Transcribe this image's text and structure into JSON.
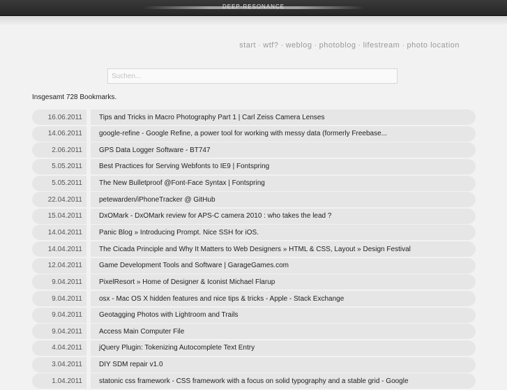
{
  "header": {
    "logo": "DEEP-RESONANCE"
  },
  "nav": {
    "items": [
      "start",
      "wtf?",
      "weblog",
      "photoblog",
      "lifestream",
      "photo location"
    ],
    "separator": "·"
  },
  "search": {
    "placeholder": "Suchen...",
    "value": ""
  },
  "summary": {
    "total_text": "Insgesamt 728 Bookmarks."
  },
  "bookmarks": [
    {
      "date": "16.06.2011",
      "title": "Tips and Tricks in Macro Photography Part 1 | Carl Zeiss Camera Lenses"
    },
    {
      "date": "14.06.2011",
      "title": "google-refine - Google Refine, a power tool for working with messy data (formerly Freebase..."
    },
    {
      "date": "2.06.2011",
      "title": "GPS Data Logger Software - BT747"
    },
    {
      "date": "5.05.2011",
      "title": "Best Practices for Serving Webfonts to IE9 | Fontspring"
    },
    {
      "date": "5.05.2011",
      "title": "The New Bulletproof @Font-Face Syntax | Fontspring"
    },
    {
      "date": "22.04.2011",
      "title": "petewarden/iPhoneTracker @ GitHub"
    },
    {
      "date": "15.04.2011",
      "title": "DxOMark - DxOMark review for APS-C camera 2010 : who takes the lead ?"
    },
    {
      "date": "14.04.2011",
      "title": "Panic Blog » Introducing Prompt. Nice SSH for iOS."
    },
    {
      "date": "14.04.2011",
      "title": "The Cicada Principle and Why It Matters to Web Designers » HTML & CSS, Layout » Design Festival"
    },
    {
      "date": "12.04.2011",
      "title": "Game Development Tools and Software | GarageGames.com"
    },
    {
      "date": "9.04.2011",
      "title": "PixelResort » Home of Designer & Iconist Michael Flarup"
    },
    {
      "date": "9.04.2011",
      "title": "osx - Mac OS X hidden features and nice tips & tricks - Apple - Stack Exchange"
    },
    {
      "date": "9.04.2011",
      "title": "Geotagging Photos with Lightroom and Trails"
    },
    {
      "date": "9.04.2011",
      "title": "Access Main Computer File"
    },
    {
      "date": "4.04.2011",
      "title": "jQuery Plugin: Tokenizing Autocomplete Text Entry"
    },
    {
      "date": "3.04.2011",
      "title": "DIY SDM repair v1.0"
    },
    {
      "date": "1.04.2011",
      "title": "statonic css framework - CSS framework with a focus on solid typography and a stable grid - Google"
    }
  ]
}
